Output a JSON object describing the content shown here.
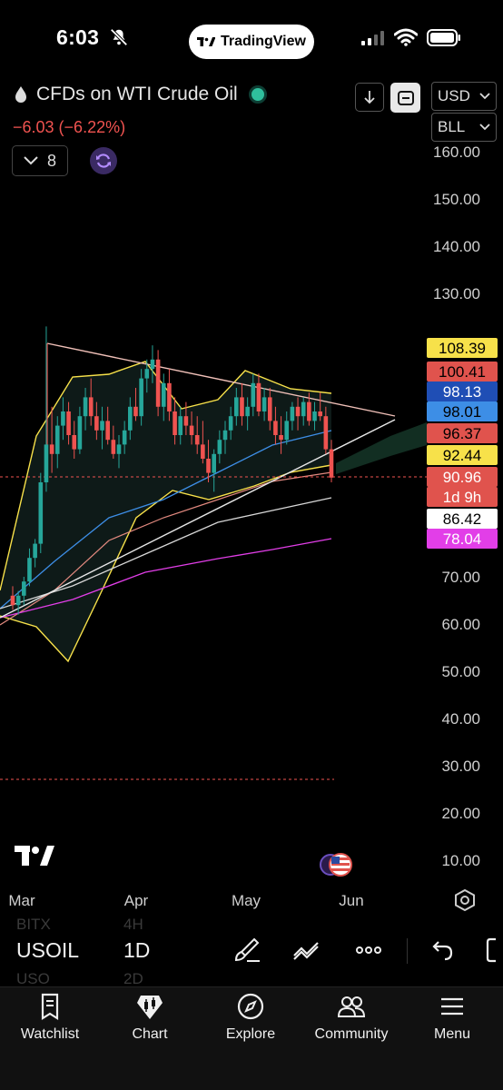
{
  "status": {
    "time": "6:03",
    "app_pill": "TradingView"
  },
  "header": {
    "title": "CFDs on WTI Crude Oil",
    "change": "−6.03 (−6.22%)",
    "indicator_count": "8",
    "currency": "USD",
    "unit": "BLL"
  },
  "axis": {
    "y_ticks": [
      "160.00",
      "150.00",
      "140.00",
      "130.00",
      "70.00",
      "60.00",
      "50.00",
      "40.00",
      "30.00",
      "20.00",
      "10.00"
    ],
    "x_ticks": [
      "Mar",
      "Apr",
      "May",
      "Jun"
    ]
  },
  "price_labels": [
    {
      "text": "108.39",
      "bg": "#f7e14a",
      "fg": "#000000"
    },
    {
      "text": "100.41",
      "bg": "#e0534d",
      "fg": "#000000"
    },
    {
      "text": "98.13",
      "bg": "#1f4eb5",
      "fg": "#ffffff"
    },
    {
      "text": "98.01",
      "bg": "#3d8ee6",
      "fg": "#000000"
    },
    {
      "text": "96.37",
      "bg": "#e0534d",
      "fg": "#000000"
    },
    {
      "text": "92.44",
      "bg": "#f7e14a",
      "fg": "#000000"
    },
    {
      "text": "90.96",
      "bg": "#e0534d",
      "fg": "#ffffff"
    },
    {
      "text": "1d 9h",
      "bg": "#e0534d",
      "fg": "#ffffff"
    },
    {
      "text": "86.42",
      "bg": "#ffffff",
      "fg": "#000000"
    },
    {
      "text": "78.04",
      "bg": "#e23ee8",
      "fg": "#ffffff"
    }
  ],
  "symbol_bar": {
    "symbol": "USOIL",
    "interval": "1D",
    "ghost_above_symbol": "BITX",
    "ghost_above_interval": "4H",
    "ghost_below_symbol": "USO",
    "ghost_below_interval": "2D"
  },
  "tabs": [
    {
      "label": "Watchlist",
      "icon": "watchlist-icon"
    },
    {
      "label": "Chart",
      "icon": "chart-icon"
    },
    {
      "label": "Explore",
      "icon": "compass-icon"
    },
    {
      "label": "Community",
      "icon": "community-icon"
    },
    {
      "label": "Menu",
      "icon": "menu-icon"
    }
  ],
  "colors": {
    "up": "#26a69a",
    "down": "#ef5350",
    "bollinger": "#f7e14a",
    "ma_blue": "#3d8ee6",
    "ma_white": "#d8d8d8",
    "ma_magenta": "#e23ee8"
  },
  "chart_data": {
    "type": "candlestick",
    "instrument": "USOIL",
    "x_ticks": [
      "Mar",
      "Apr",
      "May",
      "Jun"
    ],
    "ylim": [
      10,
      160
    ],
    "last_price": 90.96,
    "candles": [
      [
        66,
        68,
        63,
        64
      ],
      [
        64,
        67,
        62,
        66
      ],
      [
        66,
        70,
        64,
        69
      ],
      [
        69,
        76,
        68,
        74
      ],
      [
        74,
        78,
        72,
        77
      ],
      [
        77,
        92,
        75,
        90
      ],
      [
        90,
        123,
        88,
        98
      ],
      [
        98,
        106,
        92,
        96
      ],
      [
        96,
        104,
        93,
        102
      ],
      [
        102,
        108,
        99,
        105
      ],
      [
        105,
        107,
        98,
        100
      ],
      [
        100,
        103,
        95,
        97
      ],
      [
        97,
        106,
        96,
        104
      ],
      [
        104,
        110,
        101,
        108
      ],
      [
        108,
        112,
        102,
        104
      ],
      [
        104,
        107,
        99,
        101
      ],
      [
        101,
        106,
        97,
        103
      ],
      [
        103,
        106,
        98,
        99
      ],
      [
        99,
        102,
        95,
        96
      ],
      [
        96,
        100,
        93,
        98
      ],
      [
        98,
        103,
        96,
        101
      ],
      [
        101,
        108,
        99,
        106
      ],
      [
        106,
        110,
        103,
        104
      ],
      [
        104,
        114,
        102,
        112
      ],
      [
        112,
        116,
        109,
        114
      ],
      [
        114,
        119,
        111,
        116
      ],
      [
        116,
        118,
        104,
        106
      ],
      [
        106,
        113,
        103,
        111
      ],
      [
        111,
        114,
        103,
        105
      ],
      [
        105,
        108,
        98,
        100
      ],
      [
        100,
        106,
        98,
        104
      ],
      [
        104,
        107,
        100,
        102
      ],
      [
        102,
        105,
        98,
        100
      ],
      [
        100,
        104,
        96,
        98
      ],
      [
        98,
        103,
        94,
        95
      ],
      [
        95,
        99,
        90,
        92
      ],
      [
        92,
        97,
        88,
        96
      ],
      [
        96,
        101,
        94,
        99
      ],
      [
        99,
        103,
        96,
        101
      ],
      [
        101,
        106,
        99,
        104
      ],
      [
        104,
        110,
        102,
        108
      ],
      [
        108,
        111,
        102,
        104
      ],
      [
        104,
        108,
        101,
        106
      ],
      [
        106,
        113,
        104,
        111
      ],
      [
        111,
        113,
        104,
        105
      ],
      [
        105,
        110,
        103,
        108
      ],
      [
        108,
        110,
        101,
        103
      ],
      [
        103,
        106,
        98,
        100
      ],
      [
        100,
        104,
        96,
        99
      ],
      [
        99,
        105,
        98,
        103
      ],
      [
        103,
        107,
        101,
        106
      ],
      [
        106,
        108,
        101,
        104
      ],
      [
        104,
        108,
        102,
        107
      ],
      [
        107,
        109,
        102,
        103
      ],
      [
        103,
        107,
        101,
        105
      ],
      [
        105,
        109,
        103,
        104
      ],
      [
        104,
        106,
        96,
        97
      ],
      [
        97,
        99,
        90,
        91
      ]
    ]
  }
}
